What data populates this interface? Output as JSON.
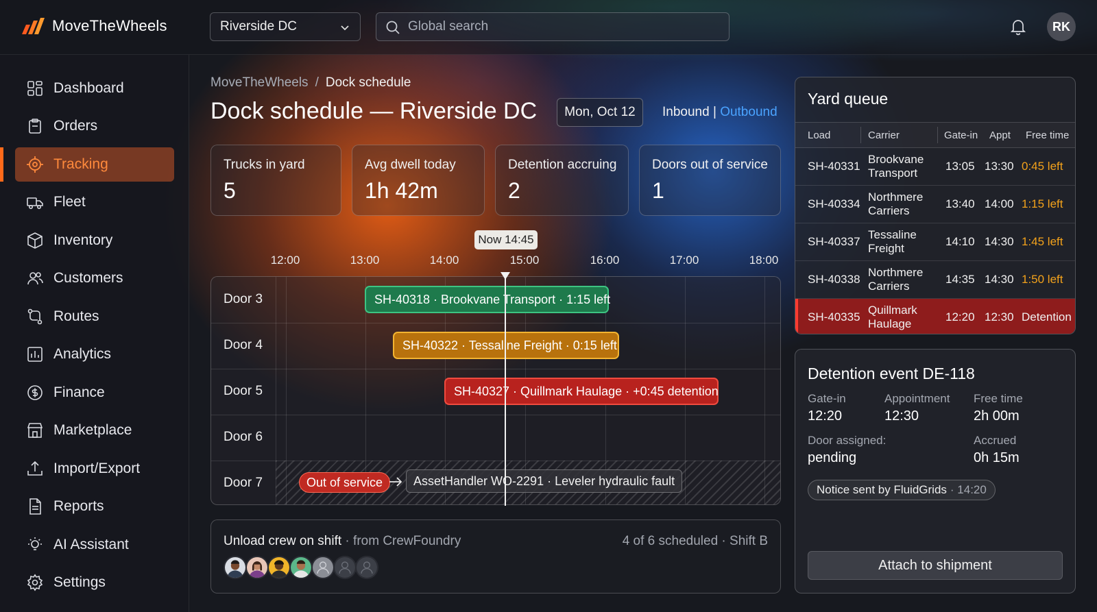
{
  "app": {
    "name": "MoveTheWheels",
    "user_initials": "RK"
  },
  "header": {
    "site_selected": "Riverside DC",
    "search_placeholder": "Global search"
  },
  "sidebar": {
    "items": [
      {
        "label": "Dashboard",
        "icon": "dashboard-icon"
      },
      {
        "label": "Orders",
        "icon": "clipboard-icon"
      },
      {
        "label": "Tracking",
        "icon": "target-icon",
        "active": true
      },
      {
        "label": "Fleet",
        "icon": "truck-icon"
      },
      {
        "label": "Inventory",
        "icon": "box-icon"
      },
      {
        "label": "Customers",
        "icon": "users-icon"
      },
      {
        "label": "Routes",
        "icon": "route-icon"
      },
      {
        "label": "Analytics",
        "icon": "chart-icon"
      },
      {
        "label": "Finance",
        "icon": "dollar-icon"
      },
      {
        "label": "Marketplace",
        "icon": "store-icon"
      },
      {
        "label": "Import/Export",
        "icon": "upload-icon"
      },
      {
        "label": "Reports",
        "icon": "document-icon"
      },
      {
        "label": "AI Assistant",
        "icon": "lightbulb-icon"
      },
      {
        "label": "Settings",
        "icon": "gear-icon"
      }
    ]
  },
  "breadcrumb": {
    "root": "MoveTheWheels",
    "separator": "/",
    "current": "Dock schedule"
  },
  "page": {
    "title": "Dock schedule — Riverside DC",
    "date": "Mon, Oct 12",
    "direction_active": "Inbound",
    "direction_sep": " | ",
    "direction_other": "Outbound"
  },
  "kpis": [
    {
      "label": "Trucks in yard",
      "value": "5"
    },
    {
      "label": "Avg dwell today",
      "value": "1h 42m"
    },
    {
      "label": "Detention accruing",
      "value": "2"
    },
    {
      "label": "Doors out of service",
      "value": "1"
    }
  ],
  "schedule": {
    "now_label": "Now 14:45",
    "ticks": [
      "12:00",
      "13:00",
      "14:00",
      "15:00",
      "16:00",
      "17:00",
      "18:00"
    ],
    "doors": [
      "Door 3",
      "Door 4",
      "Door 5",
      "Door 6",
      "Door 7"
    ],
    "bookings": [
      {
        "door": "Door 3",
        "label": "SH-40318 · Brookvane Transport · 1:15 left",
        "status": "green"
      },
      {
        "door": "Door 4",
        "label": "SH-40322 · Tessaline Freight · 0:15 left",
        "status": "amber"
      },
      {
        "door": "Door 5",
        "label": "SH-40327 · Quillmark Haulage · +0:45 detention",
        "status": "red"
      }
    ],
    "out_of_service": {
      "door": "Door 7",
      "badge": "Out of service",
      "work_order": "AssetHandler WO-2291 · Leveler hydraulic fault"
    },
    "colors": {
      "green": "#1e7a4c",
      "amber": "#b8720d",
      "red": "#b8221e"
    }
  },
  "crew": {
    "title": "Unload crew on shift",
    "source": " · from CrewFoundry",
    "meta": "4 of 6 scheduled · Shift B",
    "scheduled": 6,
    "on_shift": 4
  },
  "yard_queue": {
    "title": "Yard queue",
    "columns": [
      "Load",
      "Carrier",
      "Gate-in",
      "Appt",
      "Free time"
    ],
    "rows": [
      {
        "load": "SH-40331",
        "carrier": "Brookvane Transport",
        "gate_in": "13:05",
        "appt": "13:30",
        "free_time": "0:45 left"
      },
      {
        "load": "SH-40334",
        "carrier": "Northmere Carriers",
        "gate_in": "13:40",
        "appt": "14:00",
        "free_time": "1:15 left"
      },
      {
        "load": "SH-40337",
        "carrier": "Tessaline Freight",
        "gate_in": "14:10",
        "appt": "14:30",
        "free_time": "1:45 left"
      },
      {
        "load": "SH-40338",
        "carrier": "Northmere Carriers",
        "gate_in": "14:35",
        "appt": "14:30",
        "free_time": "1:50 left"
      },
      {
        "load": "SH-40335",
        "carrier": "Quillmark Haulage",
        "gate_in": "12:20",
        "appt": "12:30",
        "free_time": "Detention",
        "alert": true
      }
    ]
  },
  "detention": {
    "title": "Detention event DE-118",
    "gate_in_label": "Gate-in",
    "gate_in": "12:20",
    "appointment_label": "Appointment",
    "appointment": "12:30",
    "free_time_label": "Free time",
    "free_time": "2h 00m",
    "door_label": "Door assigned:",
    "door": "pending",
    "accrued_label": "Accrued",
    "accrued": "0h 15m",
    "notice": "Notice sent by FluidGrids",
    "notice_time": "· 14:20",
    "action": "Attach to shipment"
  }
}
